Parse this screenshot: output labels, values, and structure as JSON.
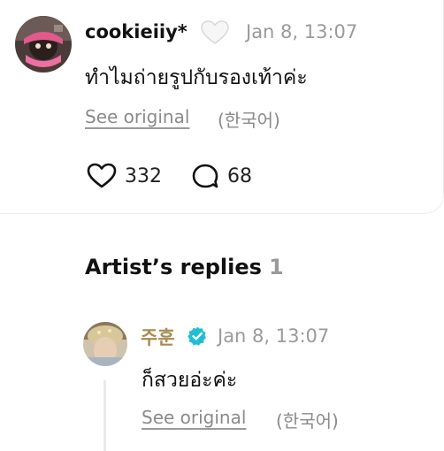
{
  "comment": {
    "username": "cookieiiy*",
    "badge_icon": "white-heart-icon",
    "timestamp": "Jan 8, 13:07",
    "text": "ทำไมถ่ายรูปกับรองเท้าค่ะ",
    "see_original": "See original",
    "language": "(한국어)",
    "likes": "332",
    "replies": "68"
  },
  "artist_replies": {
    "title": "Artist’s replies",
    "count": "1",
    "items": [
      {
        "name": "주훈",
        "verified_icon": "verified-badge-icon",
        "timestamp": "Jan 8, 13:07",
        "text": "ก็สวยอ่ะค่ะ",
        "see_original": "See original",
        "language": "(한국어)"
      }
    ]
  },
  "colors": {
    "artist_name": "#a78c52",
    "verified": "#1fbfd3",
    "muted": "#9a9a9a"
  }
}
